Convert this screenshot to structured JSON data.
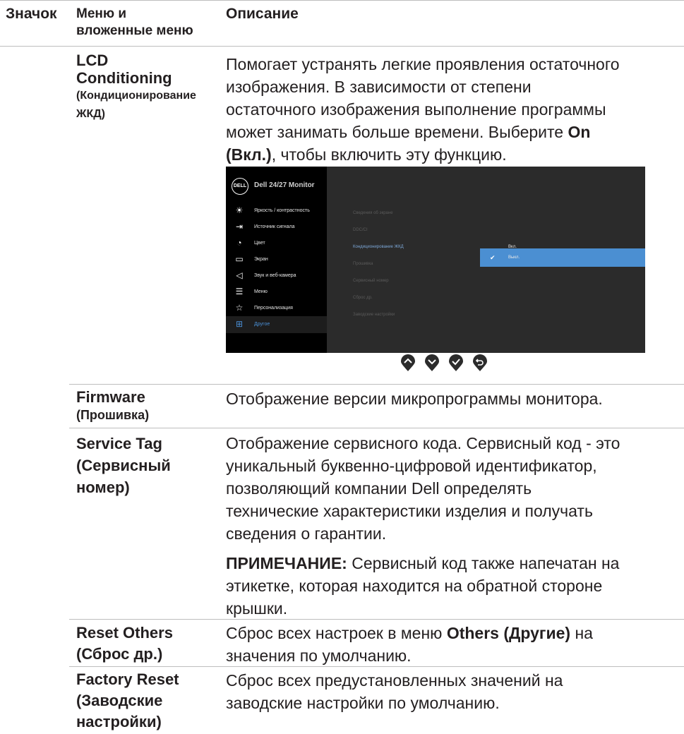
{
  "header": {
    "col_icon": "Значок",
    "col_menu_line1": "Меню и",
    "col_menu_line2": "вложенные меню",
    "col_desc": "Описание"
  },
  "rows": {
    "lcd": {
      "name_line1": "LCD",
      "name_line2": "Conditioning",
      "name_sub1": "(Кондиционирование",
      "name_sub2": "ЖКД)",
      "desc_l1": "Помогает устранять легкие проявления остаточного",
      "desc_l2": "изображения. В зависимости от степени",
      "desc_l3": "остаточного изображения выполнение программы",
      "desc_l4_a": "может занимать больше времени. Выберите ",
      "desc_l4_b": "On",
      "desc_l5_a": "(Вкл.)",
      "desc_l5_b": ", чтобы включить эту функцию."
    },
    "firmware": {
      "name_line1": "Firmware",
      "name_sub": "(Прошивка)",
      "desc": "Отображение версии микропрограммы монитора."
    },
    "service_tag": {
      "name_line1": "Service Tag",
      "name_line2": "(Сервисный",
      "name_line3": "номер)",
      "desc_l1": "Отображение сервисного кода. Сервисный код - это",
      "desc_l2": "уникальный буквенно-цифровой идентификатор,",
      "desc_l3": "позволяющий компании Dell определять",
      "desc_l4": "технические характеристики изделия и получать",
      "desc_l5": "сведения о гарантии.",
      "note_label": "ПРИМЕЧАНИЕ:",
      "note_l1": " Сервисный код также напечатан на",
      "note_l2": "этикетке, которая находится на обратной стороне",
      "note_l3": "крышки."
    },
    "reset_others": {
      "name_line1": "Reset Others",
      "name_line2": "(Сброс др.)",
      "desc_l1_a": "Сброс всех настроек в меню ",
      "desc_l1_b": "Others (Другие)",
      "desc_l1_c": " на",
      "desc_l2": "значения по умолчанию."
    },
    "factory_reset": {
      "name_line1": "Factory Reset",
      "name_line2": "(Заводские",
      "name_line3": "настройки)",
      "desc_l1": "Сброс всех предустановленных значений на",
      "desc_l2": "заводские настройки по умолчанию."
    }
  },
  "osd": {
    "logo": "DELL",
    "model": "Dell 24/27 Monitor",
    "menu": [
      {
        "label": "Яркость / контрастность",
        "icon": "brightness-icon"
      },
      {
        "label": "Источник сигнала",
        "icon": "input-source-icon"
      },
      {
        "label": "Цвет",
        "icon": "color-icon"
      },
      {
        "label": "Экран",
        "icon": "display-icon"
      },
      {
        "label": "Звук и веб-камера",
        "icon": "audio-icon"
      },
      {
        "label": "Меню",
        "icon": "menu-icon"
      },
      {
        "label": "Персонализация",
        "icon": "star-icon"
      },
      {
        "label": "Другое",
        "icon": "others-icon"
      }
    ],
    "active_menu": "Другое",
    "submenu": [
      "Сведения об экране",
      "DDC/CI",
      "Кондиционирование ЖКД",
      "Прошивка",
      "Сервисный номер",
      "Сброс др.",
      "Заводские настройки"
    ],
    "options": [
      "Вкл.",
      "Выкл."
    ],
    "selected_option": "Выкл.",
    "accent_color": "#4b8fd2"
  },
  "nav_buttons": [
    "up-icon",
    "down-icon",
    "check-icon",
    "back-icon"
  ]
}
